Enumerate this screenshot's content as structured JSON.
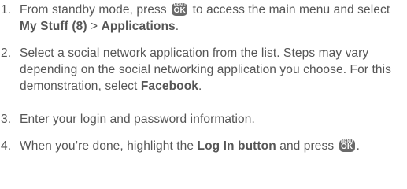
{
  "steps": [
    {
      "number": "1.",
      "t1": "From standby mode, press ",
      "t2": " to access the main menu and select ",
      "b1": "My Stuff (8)",
      "t3": " > ",
      "b2": "Applications",
      "t4": "."
    },
    {
      "number": "2.",
      "t1": "Select a social network application from the list. Steps may vary depending on the social networking application you choose. For this demonstration, select ",
      "b1": "Facebook",
      "t2": "."
    },
    {
      "number": "3.",
      "t1": "Enter your login and password information."
    },
    {
      "number": "4.",
      "t1": "When you’re done, highlight the ",
      "b1": "Log In button",
      "t2": " and press ",
      "t3": "."
    }
  ],
  "ok_key": {
    "top_label": "MENU",
    "main_label": "OK",
    "color": "#6a6a6a"
  }
}
